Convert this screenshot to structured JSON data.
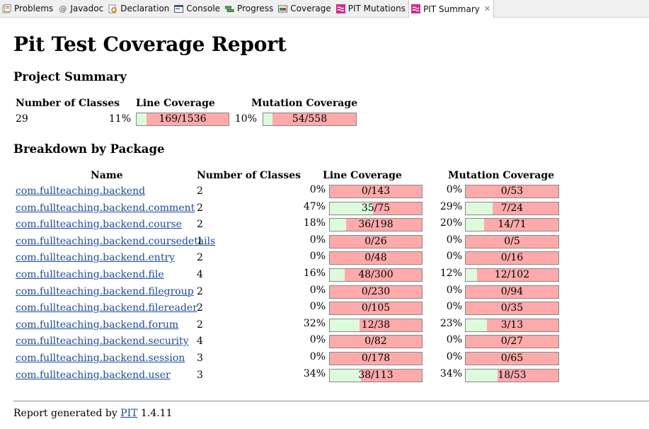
{
  "tabs": [
    {
      "label": "Problems",
      "icon": "problems-icon"
    },
    {
      "label": "Javadoc",
      "icon": "javadoc-icon"
    },
    {
      "label": "Declaration",
      "icon": "declaration-icon"
    },
    {
      "label": "Console",
      "icon": "console-icon"
    },
    {
      "label": "Progress",
      "icon": "progress-icon"
    },
    {
      "label": "Coverage",
      "icon": "coverage-icon"
    },
    {
      "label": "PIT Mutations",
      "icon": "pit-icon"
    },
    {
      "label": "PIT Summary",
      "icon": "pit-icon",
      "active": true
    }
  ],
  "report": {
    "title": "Pit Test Coverage Report",
    "project_summary_heading": "Project Summary",
    "summary_headers": {
      "classes": "Number of Classes",
      "line": "Line Coverage",
      "mutation": "Mutation Coverage"
    },
    "summary": {
      "classes": "29",
      "line_pct": "11%",
      "line_text": "169/1536",
      "line_fraction": 0.11,
      "mut_pct": "10%",
      "mut_text": "54/558",
      "mut_fraction": 0.1
    },
    "breakdown_heading": "Breakdown by Package",
    "package_headers": {
      "name": "Name",
      "classes": "Number of Classes",
      "line": "Line Coverage",
      "mutation": "Mutation Coverage"
    },
    "packages": [
      {
        "name": "com.fullteaching.backend",
        "classes": "2",
        "line_pct": "0%",
        "line_text": "0/143",
        "line_fraction": 0.0,
        "mut_pct": "0%",
        "mut_text": "0/53",
        "mut_fraction": 0.0
      },
      {
        "name": "com.fullteaching.backend.comment",
        "classes": "2",
        "line_pct": "47%",
        "line_text": "35/75",
        "line_fraction": 0.47,
        "mut_pct": "29%",
        "mut_text": "7/24",
        "mut_fraction": 0.29
      },
      {
        "name": "com.fullteaching.backend.course",
        "classes": "2",
        "line_pct": "18%",
        "line_text": "36/198",
        "line_fraction": 0.18,
        "mut_pct": "20%",
        "mut_text": "14/71",
        "mut_fraction": 0.2
      },
      {
        "name": "com.fullteaching.backend.coursedetails",
        "classes": "1",
        "line_pct": "0%",
        "line_text": "0/26",
        "line_fraction": 0.0,
        "mut_pct": "0%",
        "mut_text": "0/5",
        "mut_fraction": 0.0
      },
      {
        "name": "com.fullteaching.backend.entry",
        "classes": "2",
        "line_pct": "0%",
        "line_text": "0/48",
        "line_fraction": 0.0,
        "mut_pct": "0%",
        "mut_text": "0/16",
        "mut_fraction": 0.0
      },
      {
        "name": "com.fullteaching.backend.file",
        "classes": "4",
        "line_pct": "16%",
        "line_text": "48/300",
        "line_fraction": 0.16,
        "mut_pct": "12%",
        "mut_text": "12/102",
        "mut_fraction": 0.12
      },
      {
        "name": "com.fullteaching.backend.filegroup",
        "classes": "2",
        "line_pct": "0%",
        "line_text": "0/230",
        "line_fraction": 0.0,
        "mut_pct": "0%",
        "mut_text": "0/94",
        "mut_fraction": 0.0
      },
      {
        "name": "com.fullteaching.backend.filereader",
        "classes": "2",
        "line_pct": "0%",
        "line_text": "0/105",
        "line_fraction": 0.0,
        "mut_pct": "0%",
        "mut_text": "0/35",
        "mut_fraction": 0.0
      },
      {
        "name": "com.fullteaching.backend.forum",
        "classes": "2",
        "line_pct": "32%",
        "line_text": "12/38",
        "line_fraction": 0.32,
        "mut_pct": "23%",
        "mut_text": "3/13",
        "mut_fraction": 0.23
      },
      {
        "name": "com.fullteaching.backend.security",
        "classes": "4",
        "line_pct": "0%",
        "line_text": "0/82",
        "line_fraction": 0.0,
        "mut_pct": "0%",
        "mut_text": "0/27",
        "mut_fraction": 0.0
      },
      {
        "name": "com.fullteaching.backend.session",
        "classes": "3",
        "line_pct": "0%",
        "line_text": "0/178",
        "line_fraction": 0.0,
        "mut_pct": "0%",
        "mut_text": "0/65",
        "mut_fraction": 0.0
      },
      {
        "name": "com.fullteaching.backend.user",
        "classes": "3",
        "line_pct": "34%",
        "line_text": "38/113",
        "line_fraction": 0.34,
        "mut_pct": "34%",
        "mut_text": "18/53",
        "mut_fraction": 0.34
      }
    ],
    "footer_prefix": "Report generated by ",
    "footer_link": "PIT",
    "footer_version": " 1.4.11"
  },
  "colors": {
    "covered": "#ddfadd",
    "uncovered": "#ffaaaa",
    "link": "#1a4b9c"
  }
}
